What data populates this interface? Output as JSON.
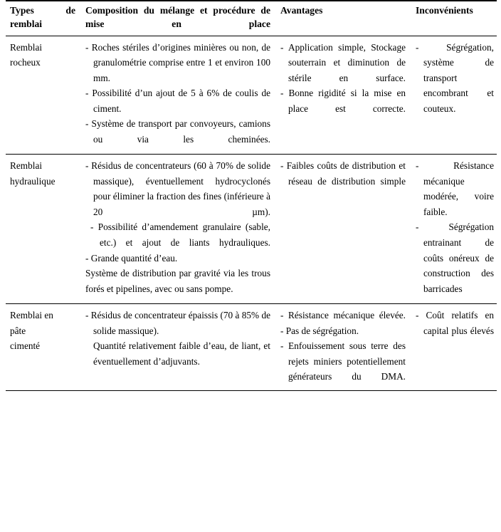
{
  "table": {
    "headers": [
      "Types de remblai",
      "Composition du mélange et procédure de mise en place",
      "Avantages",
      "Inconvénients"
    ],
    "rows": [
      {
        "type_lines": [
          "Remblai",
          "rocheux"
        ],
        "composition": [
          "- Roches stériles d’origines minières ou non, de granulométrie comprise entre 1 et environ 100 mm.",
          "- Possibilité d’un ajout de 5 à 6% de coulis de ciment.",
          "- Système de transport par convoyeurs, camions ou via les cheminées."
        ],
        "avantages": [
          "- Application simple, Stockage souterrain et diminution de stérile en surface.",
          "- Bonne rigidité si la mise en place est correcte."
        ],
        "inconvenients": [
          "- Ségrégation, système de transport encombrant et couteux."
        ]
      },
      {
        "type_lines": [
          "Remblai",
          "hydraulique"
        ],
        "composition": [
          "- Résidus de concentrateurs (60 à 70% de solide massique), éventuellement hydrocyclonés pour éliminer la fraction des fines (inférieure à 20 µm).",
          "- Possibilité d’amendement granulaire (sable, etc.) et ajout de liants hydrauliques.",
          "- Grande quantité d’eau."
        ],
        "composition_tail": "Système de distribution par gravité via les trous forés et pipelines, avec ou sans pompe.",
        "avantages": [
          "- Faibles coûts de distribution et réseau de distribution simple"
        ],
        "inconvenients": [
          "- Résistance mécanique modérée, voire faible.",
          "- Ségrégation entrainant de coûts onéreux de construction des barricades"
        ]
      },
      {
        "type_lines": [
          "Remblai en",
          "pâte",
          "cimenté"
        ],
        "composition": [
          "- Résidus de concentrateur épaissis (70 à 85% de solide massique).",
          "Quantité relativement faible d’eau, de liant, et éventuellement d’adjuvants."
        ],
        "avantages": [
          "- Résistance mécanique élevée.",
          "- Pas de ségrégation.",
          "- Enfouissement sous terre des rejets miniers potentiellement générateurs du DMA."
        ],
        "inconvenients": [
          "- Coût relatifs en capital plus élevés"
        ]
      }
    ]
  }
}
